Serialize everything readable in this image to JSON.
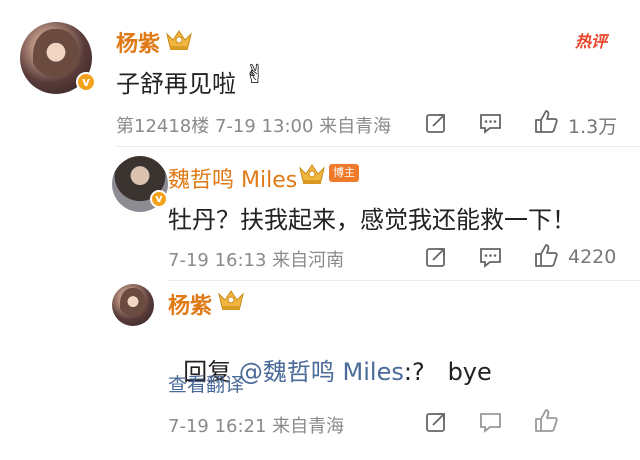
{
  "comments": [
    {
      "name": "杨紫",
      "text": "子舒再见啦",
      "meta": "第12418楼  7-19 13:00  来自青海",
      "likes": "1.3万",
      "hot_label": "热评"
    },
    {
      "name": "魏哲鸣 Miles",
      "tag": "博主",
      "text": "牡丹？扶我起来，感觉我还能救一下！",
      "meta": "7-19 16:13  来自河南",
      "likes": "4220"
    },
    {
      "name": "杨紫",
      "reply_prefix": "回复 ",
      "reply_mention": "@魏哲鸣 Miles",
      "reply_text": ":?   bye",
      "translate": "查看翻译",
      "meta": "7-19 16:21  来自青海"
    }
  ],
  "colors": {
    "name": "#e07a17",
    "hot": "#e8452c",
    "link": "#4a6a98",
    "meta": "#8a8a8a"
  },
  "icons": [
    "crown-icon",
    "verified-badge-icon",
    "share-icon",
    "comment-icon",
    "like-icon",
    "peace-emoji-icon"
  ]
}
